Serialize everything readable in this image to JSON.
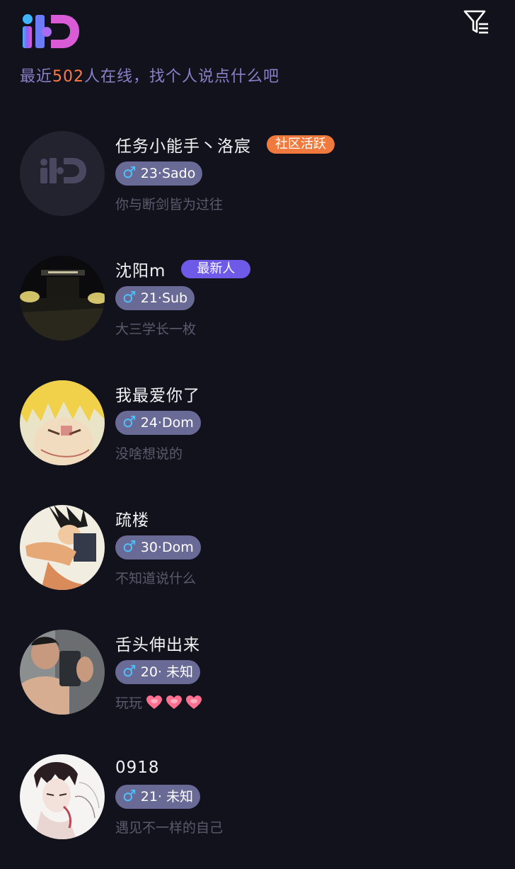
{
  "header": {
    "logo_text": "HD",
    "filter_icon": "filter-icon",
    "subtitle_prefix": "最近",
    "online_count": "502",
    "subtitle_suffix": "人在线，找个人说点什么吧"
  },
  "users": [
    {
      "name": "任务小能手丶洛宸",
      "badge": "社区活跃",
      "gender_symbol": "♂",
      "tag": "23·Sado",
      "bio": "你与断剑皆为过往",
      "avatar": "hd-logo-avatar"
    },
    {
      "name": "沈阳m",
      "badge": "最新人",
      "gender_symbol": "♂",
      "tag": "21·Sub",
      "bio": "大三学长一枚",
      "avatar": "night-photo-avatar"
    },
    {
      "name": "我最爱你了",
      "badge": "",
      "gender_symbol": "♂",
      "tag": "24·Dom",
      "bio": "没啥想说的",
      "avatar": "anime-yellow-hair-avatar"
    },
    {
      "name": "疏楼",
      "badge": "",
      "gender_symbol": "♂",
      "tag": "30·Dom",
      "bio": "不知道说什么",
      "avatar": "anime-fighter-avatar"
    },
    {
      "name": "舌头伸出来",
      "badge": "",
      "gender_symbol": "♂",
      "tag": "20· 未知",
      "bio": "玩玩",
      "bio_emoji": [
        "heart-emoji",
        "heart-emoji",
        "heart-emoji"
      ],
      "avatar": "mirror-selfie-avatar"
    },
    {
      "name": "0918",
      "badge": "",
      "gender_symbol": "♂",
      "tag": "21· 未知",
      "bio": "遇见不一样的自己",
      "avatar": "sketch-drawing-avatar"
    }
  ],
  "colors": {
    "background": "#12121c",
    "accent_orange": "#f07a3e",
    "accent_purple": "#6d5ae6",
    "tag_bg": "#6a6a96",
    "male_blue": "#4fc1ff",
    "subtitle": "#8a7fc9"
  }
}
